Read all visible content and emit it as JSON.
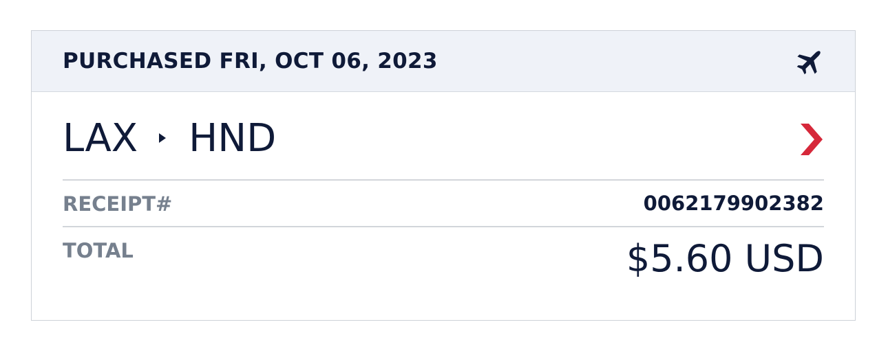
{
  "purchase": {
    "header": "PURCHASED FRI, OCT 06, 2023",
    "header_icon": "airplane-icon"
  },
  "route": {
    "origin": "LAX",
    "destination": "HND",
    "separator_icon": "triangle-right-icon",
    "action_icon": "chevron-right-icon"
  },
  "receipt": {
    "label": "RECEIPT#",
    "number": "0062179902382"
  },
  "total": {
    "label": "TOTAL",
    "amount": "$5.60 USD"
  },
  "colors": {
    "navy": "#0f1a38",
    "header_bg": "#eff2f8",
    "label_gray": "#76808e",
    "chevron_red": "#d6283a",
    "divider": "#d2d5da"
  }
}
